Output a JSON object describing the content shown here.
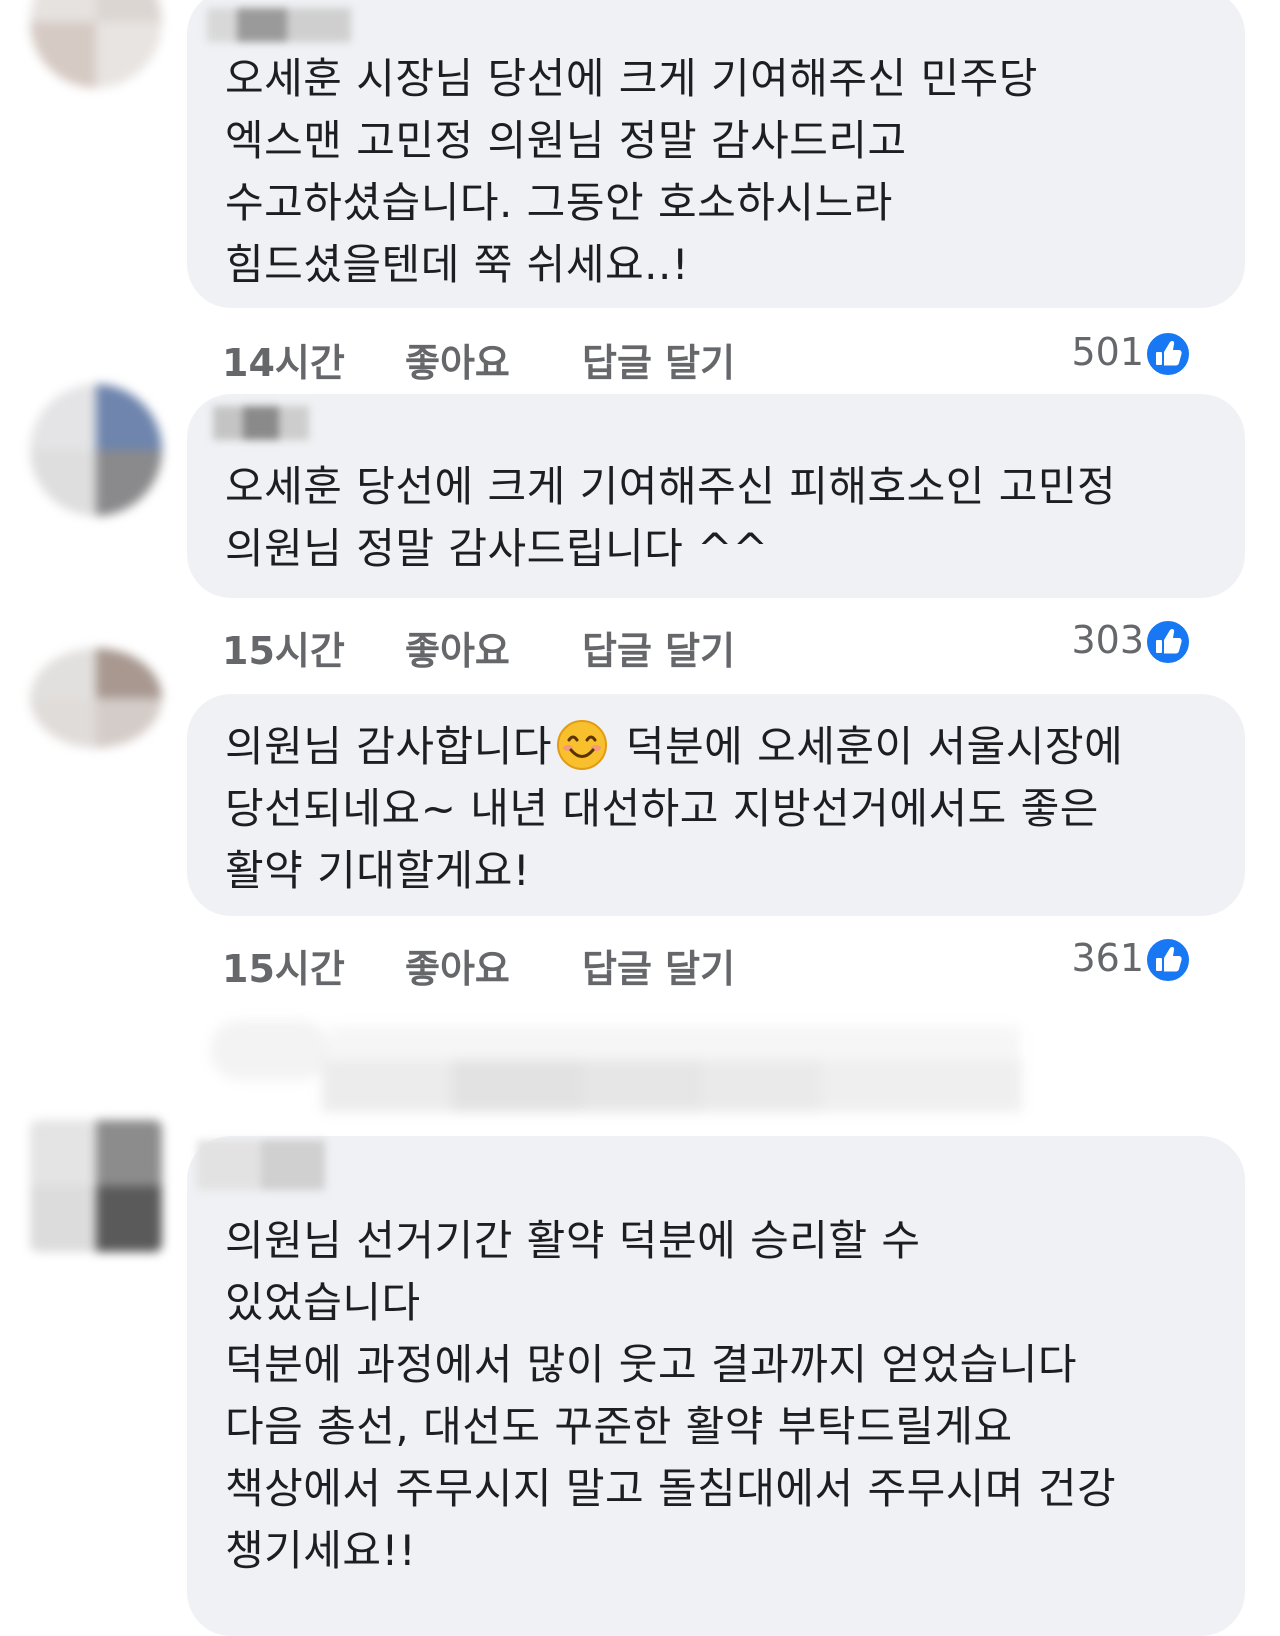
{
  "comments": [
    {
      "text": "오세훈 시장님 당선에 크게 기여해주신 민주당\n엑스맨 고민정 의원님 정말 감사드리고\n수고하셨습니다. 그동안 호소하시느라\n힘드셨을텐데 쭉 쉬세요..!",
      "time": "14시간",
      "like_label": "좋아요",
      "reply_label": "답글 달기",
      "reaction_count": "501"
    },
    {
      "text": "오세훈 당선에 크게 기여해주신 피해호소인 고민정\n의원님 정말 감사드립니다 ^^",
      "time": "15시간",
      "like_label": "좋아요",
      "reply_label": "답글 달기",
      "reaction_count": "303"
    },
    {
      "text_before_emoji": "의원님 감사합니다",
      "text_after_emoji": " 덕분에 오세훈이 서울시장에\n당선되네요~ 내년 대선하고 지방선거에서도 좋은\n활약 기대할게요!",
      "emoji": "smiling-face-icon",
      "time": "15시간",
      "like_label": "좋아요",
      "reply_label": "답글 달기",
      "reaction_count": "361"
    },
    {
      "text": "의원님 선거기간 활약 덕분에 승리할 수\n있었습니다\n덕분에 과정에서 많이 웃고 결과까지 얻었습니다\n다음 총선, 대선도 꾸준한 활약 부탁드릴게요\n책상에서 주무시지 말고 돌침대에서 주무시며 건강\n챙기세요!!"
    }
  ],
  "colors": {
    "bubble": "#eff1f4",
    "meta_text": "#65676b",
    "like_blue": "#1877f2"
  },
  "icons": {
    "reaction": "thumbs-up-icon",
    "emoji": "smiling-face-icon"
  }
}
